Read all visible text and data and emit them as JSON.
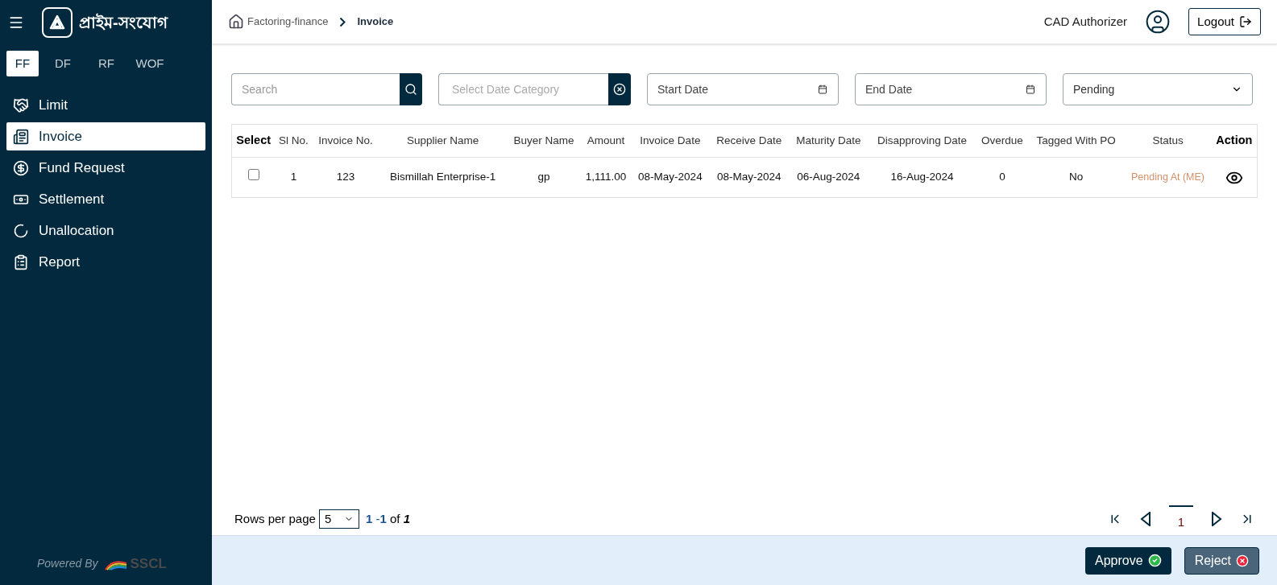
{
  "brand": {
    "name": "প্রাইম-সংযোগ"
  },
  "product_tabs": [
    {
      "label": "FF",
      "selected": true
    },
    {
      "label": "DF",
      "selected": false
    },
    {
      "label": "RF",
      "selected": false
    },
    {
      "label": "WOF",
      "selected": false
    }
  ],
  "sidebar": {
    "items": [
      {
        "label": "Limit",
        "kind": "handshake",
        "selected": false
      },
      {
        "label": "Invoice",
        "kind": "document",
        "selected": true
      },
      {
        "label": "Fund Request",
        "kind": "fund",
        "selected": false
      },
      {
        "label": "Settlement",
        "kind": "money",
        "selected": false
      },
      {
        "label": "Unallocation",
        "kind": "circle",
        "selected": false
      },
      {
        "label": "Report",
        "kind": "report",
        "selected": false
      }
    ],
    "powered_by": "Powered By",
    "powered_logo": "SSCL"
  },
  "breadcrumb": [
    "Factoring-finance",
    "Invoice"
  ],
  "user": {
    "role": "CAD Authorizer",
    "logout": "Logout"
  },
  "filters": {
    "search": {
      "placeholder": "Search"
    },
    "date_category": {
      "placeholder": "Select Date Category"
    },
    "start_date": {
      "placeholder": "Start Date"
    },
    "end_date": {
      "placeholder": "End Date"
    },
    "status": {
      "value": "Pending"
    }
  },
  "table": {
    "columns": [
      "Select",
      "Sl No.",
      "Invoice No.",
      "Supplier Name",
      "Buyer Name",
      "Amount",
      "Invoice Date",
      "Receive Date",
      "Maturity Date",
      "Disapproving Date",
      "Overdue",
      "Tagged With PO",
      "Status",
      "Action"
    ],
    "rows": [
      {
        "cells": [
          {
            "kind": "checkbox",
            "checked": false
          },
          {
            "kind": "text",
            "text": "1"
          },
          {
            "kind": "text",
            "text": "123"
          },
          {
            "kind": "text",
            "text": "Bismillah Enterprise-1"
          },
          {
            "kind": "text",
            "text": "gp"
          },
          {
            "kind": "text",
            "text": "1,111.00"
          },
          {
            "kind": "text",
            "text": "08-May-2024"
          },
          {
            "kind": "text",
            "text": "08-May-2024"
          },
          {
            "kind": "text",
            "text": "06-Aug-2024"
          },
          {
            "kind": "text",
            "text": "16-Aug-2024"
          },
          {
            "kind": "text",
            "text": "0"
          },
          {
            "kind": "text",
            "text": "No"
          },
          {
            "kind": "status",
            "text": "Pending At (ME)"
          },
          {
            "kind": "view"
          }
        ]
      }
    ]
  },
  "pagination": {
    "rows_label": "Rows per page",
    "rows_value": "5",
    "from": "1",
    "to": "-1",
    "of": "of",
    "total": "1",
    "pages": [
      {
        "label": "1",
        "selected": true
      }
    ]
  },
  "actions": [
    {
      "label": "Approve",
      "kind": "approve"
    },
    {
      "label": "Reject",
      "kind": "reject"
    }
  ]
}
